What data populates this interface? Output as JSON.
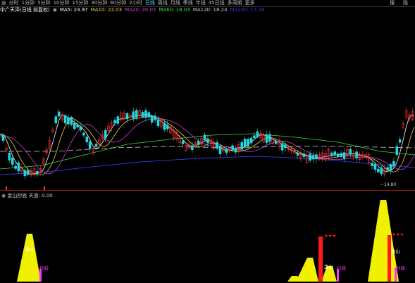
{
  "toolbar": {
    "timeframes": [
      "分时",
      "1分钟",
      "5分钟",
      "10分钟",
      "15分钟",
      "30分钟",
      "60分钟",
      "2小时",
      "日线",
      "周线",
      "月线",
      "季线",
      "年线",
      "45日线",
      "多周期",
      "更多"
    ],
    "active_index": 8,
    "right_buttons": [
      "搜",
      "隐"
    ],
    "left_icon": "grid-icon"
  },
  "info": {
    "stock": "中广天泽(日线 前复权)",
    "ma5": "MA5: 23.97",
    "ma10": "MA10: 22.03",
    "ma20": "MA20: 20.05",
    "ma60": "MA60: 18.03",
    "ma120": "MA120: 18.24",
    "ma250": "MA250: 17.28"
  },
  "colors": {
    "up": "#ff3333",
    "down": "#24d6e0",
    "ma5": "#ffffff",
    "ma10": "#e6d23c",
    "ma20": "#d63cd6",
    "ma60": "#3cdc3c",
    "ma120": "#c8c8c8",
    "ma250": "#2b3cd6",
    "signal_yellow": "#f0f000",
    "signal_red": "#ff1a1a",
    "signal_magenta": "#ff33ff"
  },
  "main_chart": {
    "low_label": "14.80",
    "note": "candles approximated"
  },
  "indicator": {
    "title": "金山抄底 天道: 0.00",
    "labels": {
      "jinshan": "金山",
      "chaodi": "抄底",
      "stars": "★★★"
    }
  }
}
